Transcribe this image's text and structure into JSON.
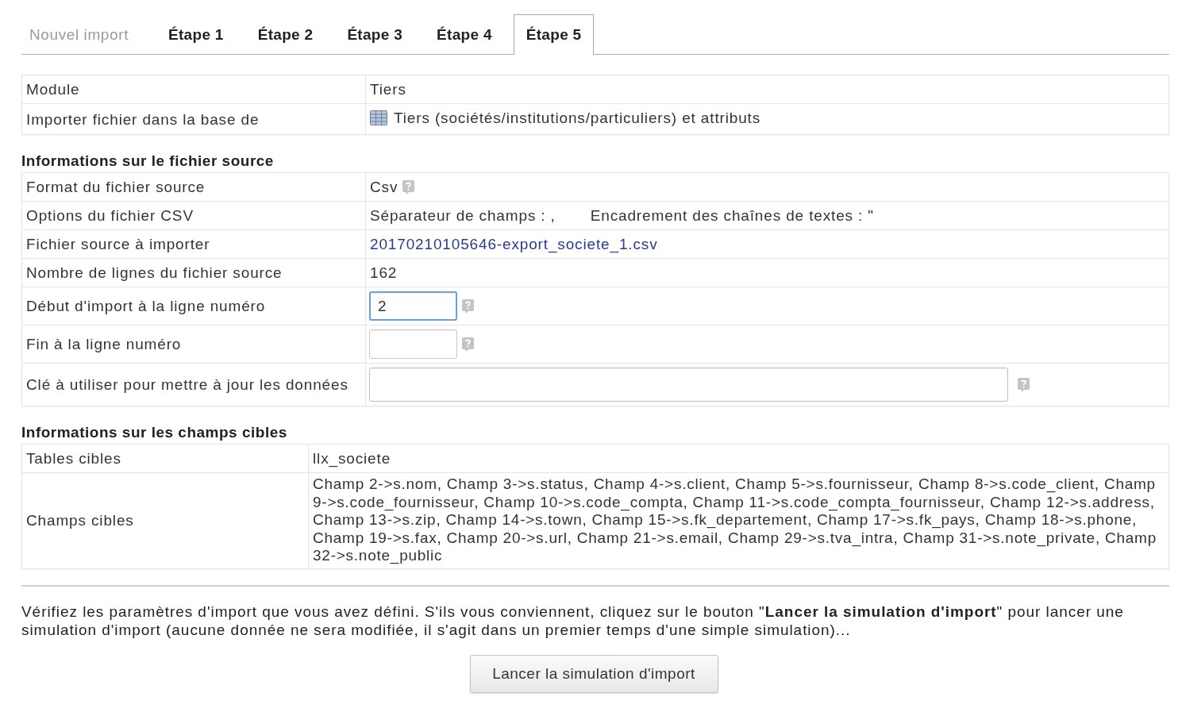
{
  "tabs": [
    {
      "label": "Nouvel import",
      "selected": false,
      "disabled": true
    },
    {
      "label": "Étape 1",
      "selected": false,
      "disabled": false
    },
    {
      "label": "Étape 2",
      "selected": false,
      "disabled": false
    },
    {
      "label": "Étape 3",
      "selected": false,
      "disabled": false
    },
    {
      "label": "Étape 4",
      "selected": false,
      "disabled": false
    },
    {
      "label": "Étape 5",
      "selected": true,
      "disabled": false
    }
  ],
  "module_table": {
    "rows": [
      {
        "kind": "text",
        "label": "Module",
        "value": "Tiers"
      },
      {
        "kind": "icon_text",
        "label": "Importer fichier dans la base de",
        "value": "Tiers (sociétés/institutions/particuliers) et attributs"
      }
    ]
  },
  "source_file": {
    "title": "Informations sur le fichier source",
    "rows": [
      {
        "kind": "help_text",
        "label": "Format du fichier source",
        "value": "Csv"
      },
      {
        "kind": "options",
        "label": "Options du fichier CSV",
        "values": [
          "Séparateur de champs : ,",
          "Encadrement des chaînes de textes : \""
        ]
      },
      {
        "kind": "link",
        "label": "Fichier source à importer",
        "value": "20170210105646-export_societe_1.csv"
      },
      {
        "kind": "text",
        "label": "Nombre de lignes du fichier source",
        "value": "162"
      },
      {
        "kind": "input_short",
        "label": "Début d'import à la ligne numéro",
        "value": "2",
        "focused": true
      },
      {
        "kind": "input_short",
        "label": "Fin à la ligne numéro",
        "focused": false
      },
      {
        "kind": "input_long",
        "label": "Clé à utiliser pour mettre à jour les données",
        "focused": false
      }
    ]
  },
  "target_fields": {
    "title": "Informations sur les champs cibles",
    "rows": [
      {
        "kind": "text",
        "label": "Tables cibles",
        "value": "llx_societe"
      },
      {
        "kind": "paragraph",
        "label": "Champs cibles",
        "value": "Champ 2->s.nom, Champ 3->s.status, Champ 4->s.client, Champ 5->s.fournisseur, Champ 8->s.code_client, Champ 9->s.code_fournisseur, Champ 10->s.code_compta, Champ 11->s.code_compta_fournisseur, Champ 12->s.address, Champ 13->s.zip, Champ 14->s.town, Champ 15->s.fk_departement, Champ 17->s.fk_pays, Champ 18->s.phone, Champ 19->s.fax, Champ 20->s.url, Champ 21->s.email, Champ 29->s.tva_intra, Champ 31->s.note_private, Champ 32->s.note_public"
      }
    ]
  },
  "instructions": "Vérifiez les paramètres d'import que vous avez défini. S'ils vous conviennent, cliquez sur le bouton \"**Lancer la simulation d'import**\" pour lancer une simulation d'import (aucune donnée ne sera modifiée, il s'agit dans un premier temps d'une simple simulation)...",
  "submit_button": "Lancer la simulation d'import"
}
